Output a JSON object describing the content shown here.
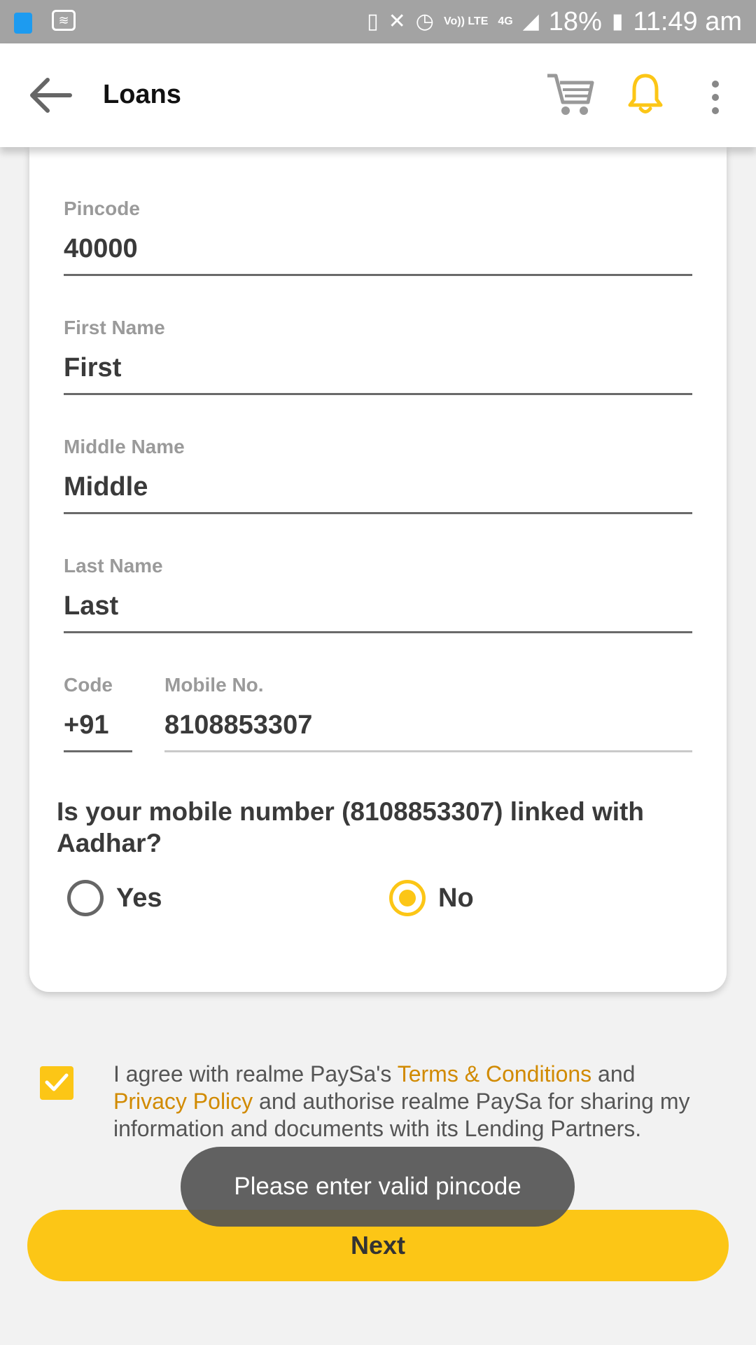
{
  "status_bar": {
    "battery": "18%",
    "time": "11:49 am",
    "network": "4G",
    "volte": "Vo)) LTE",
    "icons": [
      "shopping-bag-icon",
      "wifi-icon",
      "battery-saver-icon",
      "mute-icon",
      "alarm-icon",
      "volte-icon",
      "signal-icon",
      "battery-icon"
    ]
  },
  "app_bar": {
    "title": "Loans",
    "icons": [
      "back-arrow-icon",
      "cart-icon",
      "bell-icon",
      "more-vert-icon"
    ],
    "accent": "#fcc616"
  },
  "form": {
    "pincode": {
      "label": "Pincode",
      "value": "40000"
    },
    "first_name": {
      "label": "First Name",
      "value": "First"
    },
    "middle_name": {
      "label": "Middle Name",
      "value": "Middle"
    },
    "last_name": {
      "label": "Last Name",
      "value": "Last"
    },
    "code": {
      "label": "Code",
      "value": "+91"
    },
    "mobile": {
      "label": "Mobile No.",
      "value": "8108853307"
    },
    "question": "Is your mobile number (8108853307) linked with Aadhar?",
    "options": [
      {
        "label": "Yes",
        "selected": false
      },
      {
        "label": "No",
        "selected": true
      }
    ]
  },
  "agreement": {
    "checked": true,
    "text_1": "I agree with realme PaySa's ",
    "terms_link": "Terms & Conditions",
    "text_2": " and ",
    "privacy_link": "Privacy Policy",
    "text_3": " and authorise realme PaySa for sharing my information and documents with its Lending Partners."
  },
  "next_button": "Next",
  "toast": "Please enter valid pincode",
  "colors": {
    "accent": "#fcc616",
    "link": "#d18a00",
    "status_bar": "#a3a3a3"
  }
}
